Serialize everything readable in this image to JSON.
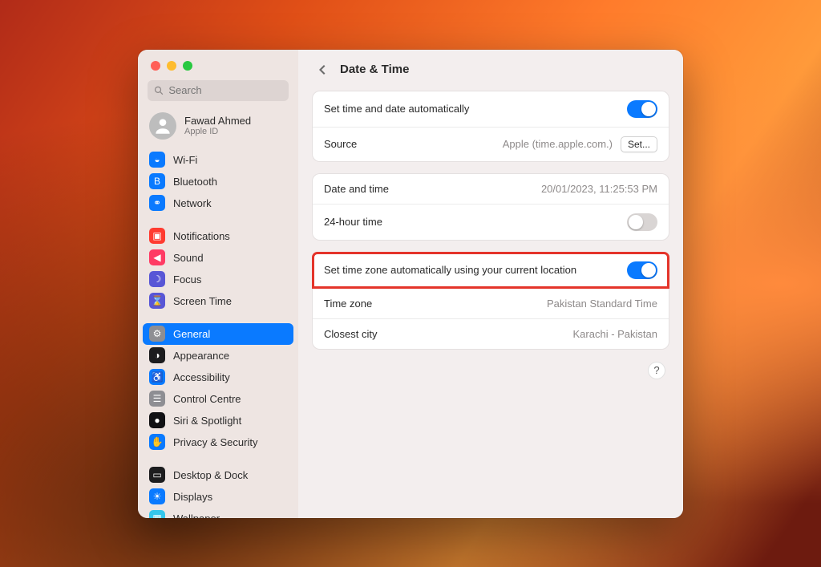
{
  "search": {
    "placeholder": "Search"
  },
  "account": {
    "name": "Fawad Ahmed",
    "sub": "Apple ID"
  },
  "sidebar": {
    "groups": [
      [
        {
          "label": "Wi-Fi",
          "color": "#0a7aff",
          "glyph": "◒"
        },
        {
          "label": "Bluetooth",
          "color": "#0a7aff",
          "glyph": "B"
        },
        {
          "label": "Network",
          "color": "#0a7aff",
          "glyph": "⚭"
        }
      ],
      [
        {
          "label": "Notifications",
          "color": "#ff3b30",
          "glyph": "▣"
        },
        {
          "label": "Sound",
          "color": "#ff3b64",
          "glyph": "◀"
        },
        {
          "label": "Focus",
          "color": "#5856d6",
          "glyph": "☽"
        },
        {
          "label": "Screen Time",
          "color": "#5856d6",
          "glyph": "⌛"
        }
      ],
      [
        {
          "label": "General",
          "color": "#8e8e93",
          "glyph": "⚙",
          "selected": true
        },
        {
          "label": "Appearance",
          "color": "#1c1c1e",
          "glyph": "◑"
        },
        {
          "label": "Accessibility",
          "color": "#0a7aff",
          "glyph": "♿"
        },
        {
          "label": "Control Centre",
          "color": "#8e8e93",
          "glyph": "☰"
        },
        {
          "label": "Siri & Spotlight",
          "color": "#111114",
          "glyph": "●"
        },
        {
          "label": "Privacy & Security",
          "color": "#0a7aff",
          "glyph": "✋"
        }
      ],
      [
        {
          "label": "Desktop & Dock",
          "color": "#1c1c1e",
          "glyph": "▭"
        },
        {
          "label": "Displays",
          "color": "#0a7aff",
          "glyph": "☀"
        },
        {
          "label": "Wallpaper",
          "color": "#34c6eb",
          "glyph": "▦"
        }
      ]
    ]
  },
  "header": {
    "title": "Date & Time"
  },
  "panels": {
    "auto": {
      "label": "Set time and date automatically",
      "state": "on",
      "source_label": "Source",
      "source_value": "Apple (time.apple.com.)",
      "set_button": "Set..."
    },
    "datetime": {
      "dt_label": "Date and time",
      "dt_value": "20/01/2023, 11:25:53 PM",
      "h24_label": "24-hour time",
      "h24_state": "off"
    },
    "tz": {
      "auto_label": "Set time zone automatically using your current location",
      "auto_state": "on",
      "tz_label": "Time zone",
      "tz_value": "Pakistan Standard Time",
      "city_label": "Closest city",
      "city_value": "Karachi - Pakistan"
    }
  },
  "help": "?"
}
